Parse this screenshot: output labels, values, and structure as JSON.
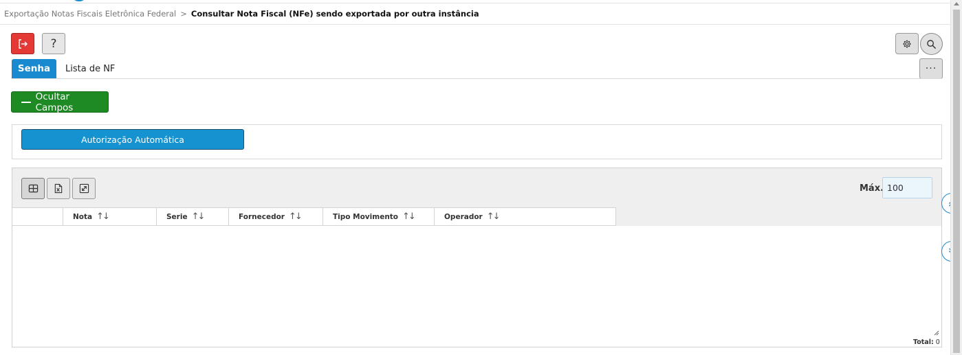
{
  "breadcrumb": {
    "parent": "Exportação Notas Fiscais Eletrônica Federal",
    "separator": ">",
    "current": "Consultar Nota Fiscal (NFe) sendo exportada por outra instância"
  },
  "toolbar": {
    "help_label": "?",
    "more_label": "···"
  },
  "tabs": [
    {
      "label": "Senha",
      "active": true
    },
    {
      "label": "Lista de NF",
      "active": false
    }
  ],
  "toggle_fields": {
    "label": "Ocultar Campos"
  },
  "actions": {
    "auto_authorization_label": "Autorização Automática"
  },
  "grid": {
    "max_label": "Máx.",
    "max_value": "100",
    "columns": [
      {
        "label": "Nota",
        "sort": "↑↓"
      },
      {
        "label": "Serie",
        "sort": "↑↓"
      },
      {
        "label": "Fornecedor",
        "sort": "↑↓"
      },
      {
        "label": "Tipo Movimento",
        "sort": "↑↓"
      },
      {
        "label": "Operador",
        "sort": "↑↓"
      }
    ],
    "rows": [],
    "total_label": "Total:",
    "total_value": "0"
  },
  "colors": {
    "primary_blue": "#1a8ad0",
    "danger_red": "#e53935",
    "success_green": "#1e8a24"
  },
  "icons": {
    "exit": "exit-icon",
    "help": "help-icon",
    "settings": "gear-icon",
    "search": "search-icon",
    "more": "ellipsis-icon",
    "grid_view": "grid-icon",
    "excel_export": "excel-icon",
    "expand": "expand-icon",
    "scroll_up": "double-chevron-up-icon",
    "scroll_down": "double-chevron-down-icon"
  }
}
